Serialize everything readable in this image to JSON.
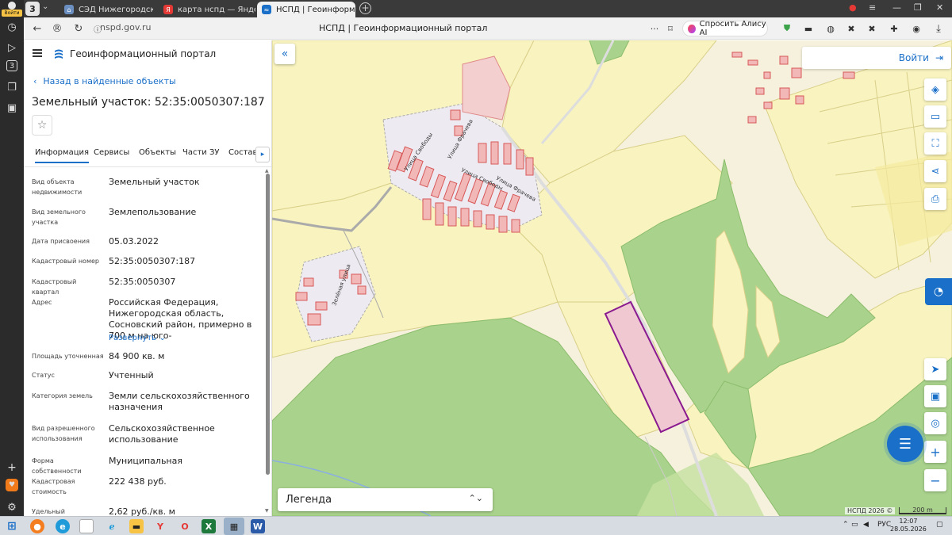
{
  "browser": {
    "rail": {
      "login_label": "Войти",
      "rail_count": "3"
    },
    "tab_count": "3",
    "tabs": [
      {
        "label": "СЭД Нижегородская обл",
        "fav_color": "#6b8fc0"
      },
      {
        "label": "карта нспд — Яндекс: нап",
        "fav_color": "#e53935"
      },
      {
        "label": "НСПД | Геоинформац",
        "fav_color": "#1a6fc8"
      }
    ],
    "url": "nspd.gov.ru",
    "page_title": "НСПД | Геоинформационный портал",
    "alice_label": "Спросить Алису AI"
  },
  "panel": {
    "portal_title": "Геоинформационный портал",
    "back_label": "Назад в найденные объекты",
    "parcel_title": "Земельный участок: 52:35:0050307:187",
    "tabs": [
      "Информация",
      "Сервисы",
      "Объекты",
      "Части ЗУ",
      "Состав"
    ],
    "fields": [
      {
        "key": "Вид объекта недвижимости",
        "value": "Земельный участок"
      },
      {
        "key": "Вид земельного участка",
        "value": "Землепользование"
      },
      {
        "key": "Дата присвоения",
        "value": "05.03.2022"
      },
      {
        "key": "Кадастровый номер",
        "value": "52:35:0050307:187"
      },
      {
        "key": "Кадастровый квартал",
        "value": "52:35:0050307"
      },
      {
        "key": "Адрес",
        "value": "Российская Федерация, Нижегородская область, Сосновский район, примерно в 700 м на юго-"
      },
      {
        "key": "Площадь уточненная",
        "value": "84 900 кв. м"
      },
      {
        "key": "Статус",
        "value": "Учтенный"
      },
      {
        "key": "Категория земель",
        "value": "Земли сельскохозяйственного назначения"
      },
      {
        "key": "Вид разрешенного использования",
        "value": "Сельскохозяйственное использование"
      },
      {
        "key": "Форма собственности",
        "value": "Муниципальная"
      },
      {
        "key": "Кадастровая стоимость",
        "value": "222 438 руб."
      },
      {
        "key": "Удельный показатель",
        "value": "2,62 руб./кв. м"
      }
    ],
    "expand_label": "Развернуть"
  },
  "map": {
    "login_label": "Войти",
    "legend_label": "Легенда",
    "copyright": "НСПД 2026 ©",
    "scale_label": "200 m",
    "street_labels": [
      "Улица Свободы",
      "Улица Фрачева",
      "Улица Свободы",
      "Улица Фрачева",
      "Зелёная улица"
    ]
  },
  "taskbar": {
    "lang": "РУС",
    "time": "12:07",
    "date": "28.05.2026"
  },
  "colors": {
    "accent": "#1a6fc8",
    "field_yellow": "#f8f3bf",
    "forest_green": "#a9d28c",
    "parcel_outline": "#8a1a8f",
    "parcel_fill": "#f0c8d2",
    "building_red": "#e06a6a"
  }
}
